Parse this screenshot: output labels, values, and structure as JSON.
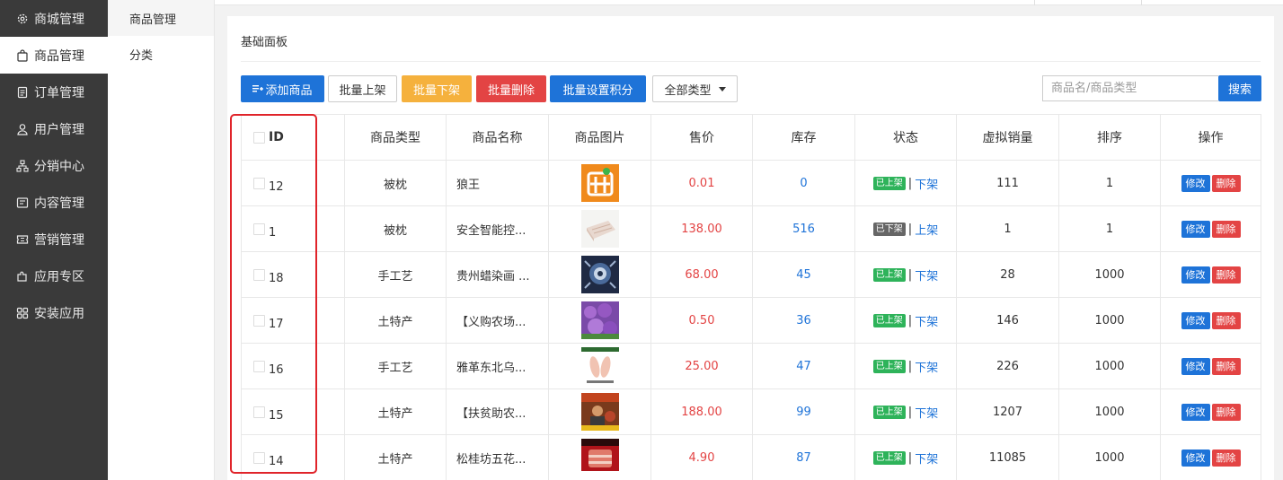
{
  "sidebar": {
    "items": [
      {
        "label": "商城管理",
        "icon": "gear-icon"
      },
      {
        "label": "商品管理",
        "icon": "bag-icon"
      },
      {
        "label": "订单管理",
        "icon": "document-icon"
      },
      {
        "label": "用户管理",
        "icon": "user-icon"
      },
      {
        "label": "分销中心",
        "icon": "network-icon"
      },
      {
        "label": "内容管理",
        "icon": "content-icon"
      },
      {
        "label": "营销管理",
        "icon": "ticket-icon"
      },
      {
        "label": "应用专区",
        "icon": "puzzle-icon"
      },
      {
        "label": "安装应用",
        "icon": "grid-icon"
      }
    ],
    "active_index": 1
  },
  "submenu": {
    "items": [
      {
        "label": "商品管理"
      },
      {
        "label": "分类"
      }
    ]
  },
  "panel": {
    "title": "基础面板"
  },
  "toolbar": {
    "add_label": "添加商品",
    "batch_on_label": "批量上架",
    "batch_off_label": "批量下架",
    "batch_delete_label": "批量删除",
    "batch_points_label": "批量设置积分",
    "type_select_label": "全部类型",
    "search_placeholder": "商品名/商品类型",
    "search_button_label": "搜索"
  },
  "table": {
    "headers": {
      "id": "ID",
      "type": "商品类型",
      "name": "商品名称",
      "image": "商品图片",
      "price": "售价",
      "stock": "库存",
      "status": "状态",
      "virtual_sales": "虚拟销量",
      "sort": "排序",
      "actions": "操作"
    },
    "rows": [
      {
        "id": "12",
        "type": "被枕",
        "name": "狼王",
        "price": "0.01",
        "stock": "0",
        "status_badge": "已上架",
        "status_action": "下架",
        "on": true,
        "virtual_sales": "111",
        "sort": "1",
        "thumb": "pin-logo"
      },
      {
        "id": "1",
        "type": "被枕",
        "name": "安全智能控...",
        "price": "138.00",
        "stock": "516",
        "status_badge": "已下架",
        "status_action": "上架",
        "on": false,
        "virtual_sales": "1",
        "sort": "1",
        "thumb": "blanket"
      },
      {
        "id": "18",
        "type": "手工艺",
        "name": "贵州蜡染画 ...",
        "price": "68.00",
        "stock": "45",
        "status_badge": "已上架",
        "status_action": "下架",
        "on": true,
        "virtual_sales": "28",
        "sort": "1000",
        "thumb": "batik"
      },
      {
        "id": "17",
        "type": "土特产",
        "name": "【义购农场...",
        "price": "0.50",
        "stock": "36",
        "status_badge": "已上架",
        "status_action": "下架",
        "on": true,
        "virtual_sales": "146",
        "sort": "1000",
        "thumb": "purple"
      },
      {
        "id": "16",
        "type": "手工艺",
        "name": "雅革东北乌...",
        "price": "25.00",
        "stock": "47",
        "status_badge": "已上架",
        "status_action": "下架",
        "on": true,
        "virtual_sales": "226",
        "sort": "1000",
        "thumb": "insoles"
      },
      {
        "id": "15",
        "type": "土特产",
        "name": "【扶贫助农...",
        "price": "188.00",
        "stock": "99",
        "status_badge": "已上架",
        "status_action": "下架",
        "on": true,
        "virtual_sales": "1207",
        "sort": "1000",
        "thumb": "farmer"
      },
      {
        "id": "14",
        "type": "土特产",
        "name": "松桂坊五花...",
        "price": "4.90",
        "stock": "87",
        "status_badge": "已上架",
        "status_action": "下架",
        "on": true,
        "virtual_sales": "11085",
        "sort": "1000",
        "thumb": "meat"
      }
    ],
    "edit_label": "修改",
    "delete_label": "删除"
  },
  "colors": {
    "primary": "#1e73d8",
    "danger": "#e34444",
    "warning": "#f5b13d",
    "success": "#2eb35a",
    "sidebar_bg": "#3a3a3a",
    "highlight": "#e0242a"
  }
}
